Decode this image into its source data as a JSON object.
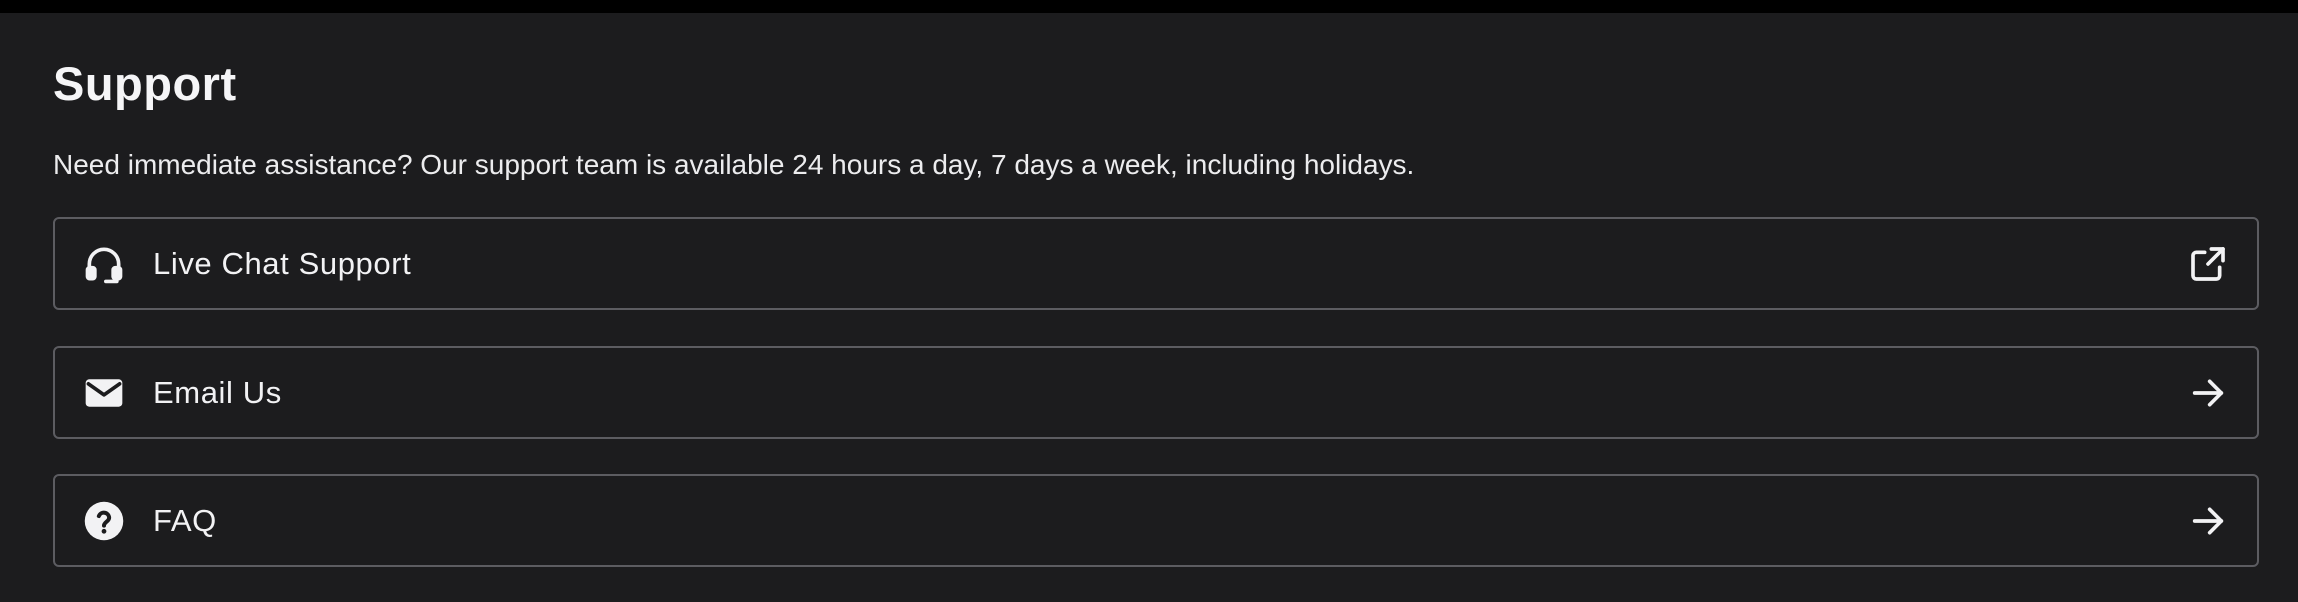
{
  "support": {
    "title": "Support",
    "description": "Need immediate assistance? Our support team is available 24 hours a day, 7 days a week, including holidays.",
    "options": [
      {
        "label": "Live Chat Support",
        "icon": "headset-icon",
        "action_icon": "open-in-new-icon"
      },
      {
        "label": "Email Us",
        "icon": "mail-icon",
        "action_icon": "arrow-right-icon"
      },
      {
        "label": "FAQ",
        "icon": "help-circle-icon",
        "action_icon": "arrow-right-icon"
      }
    ]
  },
  "colors": {
    "background": "#1c1c1e",
    "top_bar": "#000000",
    "text": "#f2f2f4",
    "border": "#5c5c61"
  }
}
